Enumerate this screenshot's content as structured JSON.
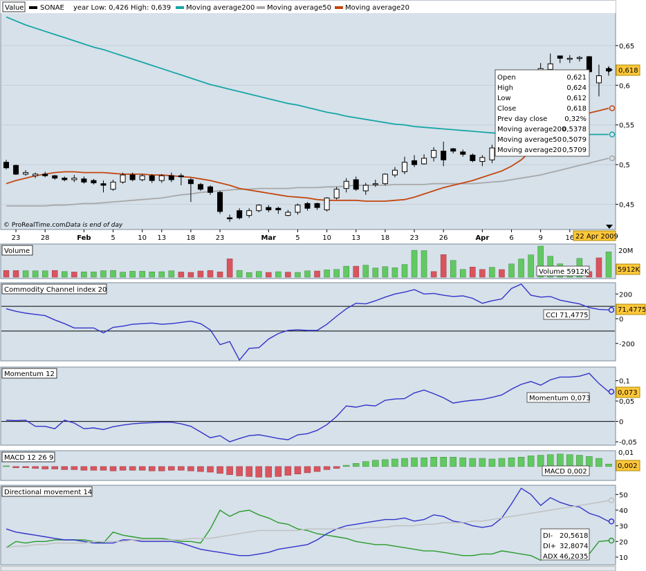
{
  "header": {
    "value_label": "Value",
    "symbol": "SONAE",
    "year_range": "year Low: 0,426 High: 0,639",
    "ma200_label": "Moving average200",
    "ma50_label": "Moving average50",
    "ma20_label": "Moving average20"
  },
  "colors": {
    "panel_bg": "#d6e1ea",
    "ma200": "#17a5a5",
    "ma50": "#a8a8a8",
    "ma20": "#c4460e",
    "indicator": "#3232c8",
    "up_bar": "#62c962",
    "down_bar": "#d9545f",
    "di_minus": "#2a9a2a",
    "adx": "#bfbfbf",
    "highlight": "#ffc73a"
  },
  "price_panel": {
    "copyright": "© ProRealTime.com",
    "note": "Data is end of day",
    "y_ticks": [
      "0,65",
      "0,6",
      "0,55",
      "0,5",
      "0,45"
    ],
    "last_price": "0,618",
    "date_highlight": "22 Apr 2009",
    "x_labels": [
      "23",
      "28",
      "Feb",
      "5",
      "10",
      "13",
      "18",
      "23",
      "Mar",
      "5",
      "10",
      "13",
      "18",
      "23",
      "26",
      "Apr",
      "6",
      "9",
      "16"
    ],
    "tooltip": {
      "open_label": "Open",
      "open": "0,621",
      "high_label": "High",
      "high": "0,624",
      "low_label": "Low",
      "low": "0,612",
      "close_label": "Close",
      "close": "0,618",
      "prev_label": "Prev day close",
      "prev": "0,32%",
      "ma200_label": "Moving average200",
      "ma200": "0,5378",
      "ma50_label": "Moving average50",
      "ma50": "0,5079",
      "ma20_label": "Moving average20",
      "ma20": "0,5709"
    }
  },
  "volume_panel": {
    "title": "Volume",
    "y_tick": "20M",
    "readout": "Volume 5912K",
    "last": "5912K"
  },
  "cci_panel": {
    "title": "Commodity Channel index 20",
    "y_ticks": [
      "200",
      "0",
      "-200"
    ],
    "readout": "CCI 71,4775",
    "last": "71,4775"
  },
  "momentum_panel": {
    "title": "Momentum 12",
    "y_ticks": [
      "0,1",
      "0,05",
      "0",
      "-0,05"
    ],
    "readout": "Momentum 0,073",
    "last": "0,073"
  },
  "macd_panel": {
    "title": "MACD 12 26 9",
    "y_tick": "0,01",
    "readout": "MACD 0,002",
    "last": "0,002"
  },
  "dmi_panel": {
    "title": "Directional movement 14",
    "y_ticks": [
      "50",
      "40",
      "30",
      "20",
      "10"
    ],
    "di_minus_label": "DI-",
    "di_minus": "20,5618",
    "di_plus_label": "DI+",
    "di_plus": "32,8074",
    "adx_label": "ADX",
    "adx": "46,2035"
  },
  "chart_data": [
    {
      "type": "candlestick",
      "title": "SONAE",
      "ylim": [
        0.42,
        0.69
      ],
      "x": [
        "Jan 22",
        "Jan 23",
        "Jan 26",
        "Jan 27",
        "Jan 28",
        "Jan 29",
        "Jan 30",
        "Feb 2",
        "Feb 3",
        "Feb 4",
        "Feb 5",
        "Feb 6",
        "Feb 9",
        "Feb 10",
        "Feb 11",
        "Feb 12",
        "Feb 13",
        "Feb 16",
        "Feb 17",
        "Feb 18",
        "Feb 19",
        "Feb 20",
        "Feb 23",
        "Feb 24",
        "Feb 25",
        "Feb 26",
        "Feb 27",
        "Mar 2",
        "Mar 3",
        "Mar 4",
        "Mar 5",
        "Mar 6",
        "Mar 9",
        "Mar 10",
        "Mar 11",
        "Mar 12",
        "Mar 13",
        "Mar 16",
        "Mar 17",
        "Mar 18",
        "Mar 19",
        "Mar 20",
        "Mar 23",
        "Mar 24",
        "Mar 25",
        "Mar 26",
        "Mar 27",
        "Mar 30",
        "Mar 31",
        "Apr 1",
        "Apr 2",
        "Apr 3",
        "Apr 6",
        "Apr 7",
        "Apr 8",
        "Apr 9",
        "Apr 14",
        "Apr 15",
        "Apr 16",
        "Apr 17",
        "Apr 20",
        "Apr 21",
        "Apr 22"
      ],
      "open": [
        0.503,
        0.499,
        0.488,
        0.486,
        0.488,
        0.486,
        0.483,
        0.481,
        0.482,
        0.48,
        0.476,
        0.469,
        0.478,
        0.487,
        0.481,
        0.486,
        0.48,
        0.486,
        0.486,
        0.481,
        0.475,
        0.472,
        0.465,
        0.433,
        0.442,
        0.436,
        0.442,
        0.446,
        0.445,
        0.436,
        0.44,
        0.451,
        0.451,
        0.443,
        0.458,
        0.47,
        0.481,
        0.467,
        0.475,
        0.476,
        0.487,
        0.491,
        0.505,
        0.501,
        0.509,
        0.517,
        0.52,
        0.516,
        0.512,
        0.504,
        0.506,
        0.539,
        0.528,
        0.518,
        0.556,
        0.598,
        0.62,
        0.637,
        0.634,
        0.634,
        0.636,
        0.603,
        0.621
      ],
      "close": [
        0.496,
        0.488,
        0.49,
        0.488,
        0.486,
        0.483,
        0.481,
        0.483,
        0.478,
        0.477,
        0.474,
        0.478,
        0.487,
        0.481,
        0.486,
        0.48,
        0.486,
        0.481,
        0.485,
        0.476,
        0.469,
        0.465,
        0.441,
        0.432,
        0.433,
        0.442,
        0.449,
        0.443,
        0.443,
        0.44,
        0.449,
        0.445,
        0.446,
        0.458,
        0.469,
        0.479,
        0.469,
        0.474,
        0.476,
        0.488,
        0.493,
        0.503,
        0.5,
        0.508,
        0.518,
        0.506,
        0.517,
        0.513,
        0.505,
        0.509,
        0.521,
        0.526,
        0.544,
        0.556,
        0.595,
        0.621,
        0.627,
        0.634,
        0.634,
        0.635,
        0.617,
        0.612,
        0.618
      ],
      "high": [
        0.506,
        0.5,
        0.493,
        0.49,
        0.491,
        0.487,
        0.485,
        0.487,
        0.485,
        0.482,
        0.48,
        0.481,
        0.49,
        0.49,
        0.488,
        0.488,
        0.488,
        0.49,
        0.489,
        0.483,
        0.477,
        0.474,
        0.467,
        0.437,
        0.445,
        0.445,
        0.45,
        0.449,
        0.447,
        0.443,
        0.451,
        0.453,
        0.452,
        0.459,
        0.472,
        0.483,
        0.485,
        0.477,
        0.481,
        0.489,
        0.497,
        0.51,
        0.512,
        0.513,
        0.522,
        0.529,
        0.521,
        0.519,
        0.514,
        0.512,
        0.525,
        0.542,
        0.552,
        0.561,
        0.6,
        0.628,
        0.64,
        0.637,
        0.638,
        0.637,
        0.637,
        0.626,
        0.624
      ],
      "low": [
        0.494,
        0.487,
        0.486,
        0.483,
        0.484,
        0.481,
        0.479,
        0.478,
        0.476,
        0.475,
        0.465,
        0.467,
        0.476,
        0.479,
        0.479,
        0.477,
        0.477,
        0.478,
        0.474,
        0.453,
        0.467,
        0.462,
        0.438,
        0.428,
        0.431,
        0.433,
        0.44,
        0.44,
        0.438,
        0.435,
        0.437,
        0.442,
        0.443,
        0.441,
        0.456,
        0.465,
        0.467,
        0.462,
        0.472,
        0.474,
        0.484,
        0.488,
        0.497,
        0.5,
        0.504,
        0.498,
        0.514,
        0.51,
        0.503,
        0.498,
        0.502,
        0.521,
        0.522,
        0.515,
        0.552,
        0.595,
        0.618,
        0.628,
        0.628,
        0.63,
        0.613,
        0.586,
        0.612
      ],
      "ma200": [
        0.686,
        0.681,
        0.676,
        0.672,
        0.668,
        0.664,
        0.66,
        0.656,
        0.652,
        0.648,
        0.645,
        0.641,
        0.637,
        0.633,
        0.629,
        0.625,
        0.621,
        0.617,
        0.613,
        0.609,
        0.605,
        0.601,
        0.598,
        0.595,
        0.592,
        0.589,
        0.586,
        0.583,
        0.58,
        0.577,
        0.575,
        0.572,
        0.569,
        0.566,
        0.564,
        0.561,
        0.559,
        0.557,
        0.555,
        0.553,
        0.551,
        0.55,
        0.548,
        0.547,
        0.546,
        0.545,
        0.544,
        0.543,
        0.542,
        0.541,
        0.54,
        0.539,
        0.539,
        0.538,
        0.538,
        0.538,
        0.538,
        0.538,
        0.538,
        0.538,
        0.538,
        0.538,
        0.538
      ],
      "ma50": [
        0.448,
        0.448,
        0.448,
        0.448,
        0.448,
        0.449,
        0.449,
        0.45,
        0.451,
        0.451,
        0.452,
        0.453,
        0.454,
        0.455,
        0.456,
        0.457,
        0.458,
        0.46,
        0.462,
        0.463,
        0.465,
        0.466,
        0.467,
        0.468,
        0.469,
        0.469,
        0.47,
        0.47,
        0.47,
        0.47,
        0.471,
        0.471,
        0.471,
        0.472,
        0.472,
        0.473,
        0.474,
        0.474,
        0.474,
        0.474,
        0.475,
        0.475,
        0.475,
        0.475,
        0.476,
        0.476,
        0.476,
        0.476,
        0.476,
        0.477,
        0.478,
        0.479,
        0.481,
        0.483,
        0.485,
        0.487,
        0.49,
        0.493,
        0.496,
        0.499,
        0.502,
        0.505,
        0.508
      ],
      "ma20": [
        0.476,
        0.48,
        0.483,
        0.486,
        0.488,
        0.49,
        0.491,
        0.491,
        0.49,
        0.49,
        0.49,
        0.489,
        0.488,
        0.488,
        0.488,
        0.487,
        0.487,
        0.486,
        0.485,
        0.484,
        0.482,
        0.48,
        0.477,
        0.474,
        0.47,
        0.468,
        0.466,
        0.464,
        0.462,
        0.46,
        0.459,
        0.458,
        0.456,
        0.455,
        0.455,
        0.455,
        0.455,
        0.454,
        0.454,
        0.454,
        0.455,
        0.456,
        0.459,
        0.463,
        0.467,
        0.471,
        0.474,
        0.477,
        0.48,
        0.484,
        0.488,
        0.492,
        0.498,
        0.506,
        0.517,
        0.528,
        0.537,
        0.546,
        0.554,
        0.56,
        0.565,
        0.568,
        0.571
      ]
    },
    {
      "type": "bar",
      "title": "Volume",
      "ylim": [
        0,
        22000000
      ],
      "values": [
        4800000,
        4700000,
        4600000,
        4500000,
        4500000,
        4800000,
        4000000,
        3700000,
        3800000,
        3700000,
        4600000,
        4800000,
        3600000,
        4200000,
        4200000,
        3800000,
        3900000,
        4500000,
        3700000,
        3400000,
        4400000,
        4800000,
        3800000,
        13000000,
        4800000,
        3300000,
        4100000,
        3400000,
        3900000,
        3600000,
        3400000,
        4500000,
        4400000,
        5200000,
        5500000,
        7800000,
        7800000,
        8500000,
        6500000,
        7500000,
        6700000,
        9000000,
        19000000,
        18800000,
        4000000,
        16000000,
        11900000,
        5500000,
        7200000,
        5500000,
        7000000,
        5400000,
        9400000,
        12900000,
        15800000,
        22000000,
        14800000,
        9500000,
        7200000,
        13300000,
        4000000,
        13700000,
        17900000
      ],
      "up": [
        false,
        false,
        true,
        true,
        true,
        false,
        true,
        false,
        true,
        true,
        true,
        true,
        true,
        true,
        true,
        true,
        true,
        true,
        false,
        false,
        false,
        false,
        false,
        false,
        true,
        true,
        true,
        false,
        true,
        false,
        true,
        true,
        false,
        true,
        true,
        true,
        false,
        true,
        true,
        true,
        true,
        true,
        true,
        true,
        false,
        false,
        true,
        true,
        false,
        false,
        true,
        false,
        true,
        true,
        true,
        true,
        true,
        true,
        true,
        true,
        false,
        false,
        true
      ]
    },
    {
      "type": "line",
      "title": "Commodity Channel index 20",
      "ylim": [
        -330,
        280
      ],
      "values": [
        80,
        60,
        45,
        35,
        25,
        -10,
        -40,
        -75,
        -75,
        -75,
        -115,
        -70,
        -60,
        -45,
        -40,
        -35,
        -45,
        -40,
        -30,
        -20,
        -40,
        -90,
        -210,
        -185,
        -335,
        -240,
        -235,
        -165,
        -120,
        -95,
        -90,
        -95,
        -95,
        -45,
        20,
        80,
        125,
        120,
        145,
        175,
        200,
        215,
        235,
        200,
        205,
        190,
        180,
        185,
        165,
        125,
        145,
        160,
        245,
        280,
        190,
        175,
        180,
        150,
        135,
        120,
        90,
        75,
        71.4775
      ]
    },
    {
      "type": "line",
      "title": "Momentum 12",
      "ylim": [
        -0.055,
        0.13
      ],
      "values": [
        0.003,
        0.002,
        0.003,
        -0.012,
        -0.012,
        -0.018,
        0.003,
        -0.004,
        -0.018,
        -0.016,
        -0.02,
        -0.013,
        -0.009,
        -0.006,
        -0.004,
        -0.003,
        -0.002,
        -0.002,
        -0.006,
        -0.012,
        -0.026,
        -0.04,
        -0.035,
        -0.05,
        -0.042,
        -0.035,
        -0.033,
        -0.037,
        -0.042,
        -0.045,
        -0.033,
        -0.03,
        -0.022,
        -0.008,
        0.012,
        0.038,
        0.035,
        0.04,
        0.038,
        0.052,
        0.055,
        0.056,
        0.07,
        0.077,
        0.068,
        0.058,
        0.045,
        0.049,
        0.052,
        0.054,
        0.059,
        0.065,
        0.079,
        0.091,
        0.098,
        0.089,
        0.102,
        0.109,
        0.109,
        0.111,
        0.118,
        0.093,
        0.073
      ]
    },
    {
      "type": "bar",
      "title": "MACD 12 26 9",
      "ylim": [
        -0.01,
        0.0115
      ],
      "values": [
        0.0005,
        -0.001,
        -0.001,
        -0.0015,
        -0.002,
        -0.002,
        -0.0025,
        -0.0025,
        -0.003,
        -0.003,
        -0.003,
        -0.0035,
        -0.003,
        -0.003,
        -0.003,
        -0.0035,
        -0.0035,
        -0.003,
        -0.003,
        -0.0035,
        -0.004,
        -0.0045,
        -0.0055,
        -0.0065,
        -0.0075,
        -0.008,
        -0.0085,
        -0.0085,
        -0.008,
        -0.007,
        -0.006,
        -0.005,
        -0.004,
        -0.0025,
        -0.0015,
        0.001,
        0.0025,
        0.004,
        0.005,
        0.0055,
        0.006,
        0.0065,
        0.007,
        0.007,
        0.0075,
        0.0075,
        0.0075,
        0.007,
        0.0065,
        0.0065,
        0.006,
        0.0065,
        0.007,
        0.0075,
        0.0085,
        0.009,
        0.0095,
        0.01,
        0.0095,
        0.009,
        0.008,
        0.0065,
        0.002
      ]
    },
    {
      "type": "line",
      "title": "Directional movement 14",
      "ylim": [
        6,
        55
      ],
      "series": [
        {
          "name": "DI-",
          "values": [
            16,
            20,
            19,
            20,
            20,
            21,
            21,
            21,
            21,
            20,
            19,
            26,
            24,
            23,
            22,
            22,
            22,
            21,
            20,
            20,
            19,
            28,
            40,
            36,
            39,
            40,
            37,
            35,
            32,
            31,
            28,
            27,
            25,
            24,
            23,
            22,
            20,
            19,
            18,
            18,
            17,
            16,
            15,
            14,
            14,
            13,
            12,
            11,
            11,
            12,
            12,
            14,
            13,
            12,
            11,
            8,
            14,
            13,
            14,
            15,
            12,
            20,
            20.5618
          ]
        },
        {
          "name": "DI+",
          "values": [
            28,
            26,
            25,
            24,
            23,
            22,
            21,
            21,
            20,
            19,
            19,
            19,
            21,
            21,
            20,
            20,
            20,
            20,
            19,
            17,
            15,
            14,
            13,
            12,
            11,
            11,
            12,
            13,
            15,
            16,
            17,
            18,
            21,
            25,
            28,
            30,
            31,
            32,
            33,
            34,
            34,
            35,
            33,
            34,
            37,
            36,
            33,
            32,
            30,
            29,
            30,
            35,
            44,
            54,
            50,
            43,
            48,
            45,
            43,
            42,
            38,
            36,
            32.8074
          ]
        },
        {
          "name": "ADX",
          "values": [
            16,
            17,
            17,
            18,
            18,
            19,
            19,
            19,
            19,
            20,
            20,
            20,
            20,
            21,
            21,
            21,
            21,
            21,
            21,
            22,
            22,
            22,
            23,
            24,
            25,
            26,
            27,
            27,
            27,
            27,
            27,
            28,
            28,
            28,
            28,
            28,
            28,
            29,
            29,
            29,
            30,
            30,
            30,
            31,
            31,
            32,
            32,
            32,
            33,
            33,
            34,
            35,
            36,
            37,
            38,
            39,
            40,
            41,
            42,
            43,
            44,
            45,
            46.2035
          ]
        }
      ]
    }
  ]
}
